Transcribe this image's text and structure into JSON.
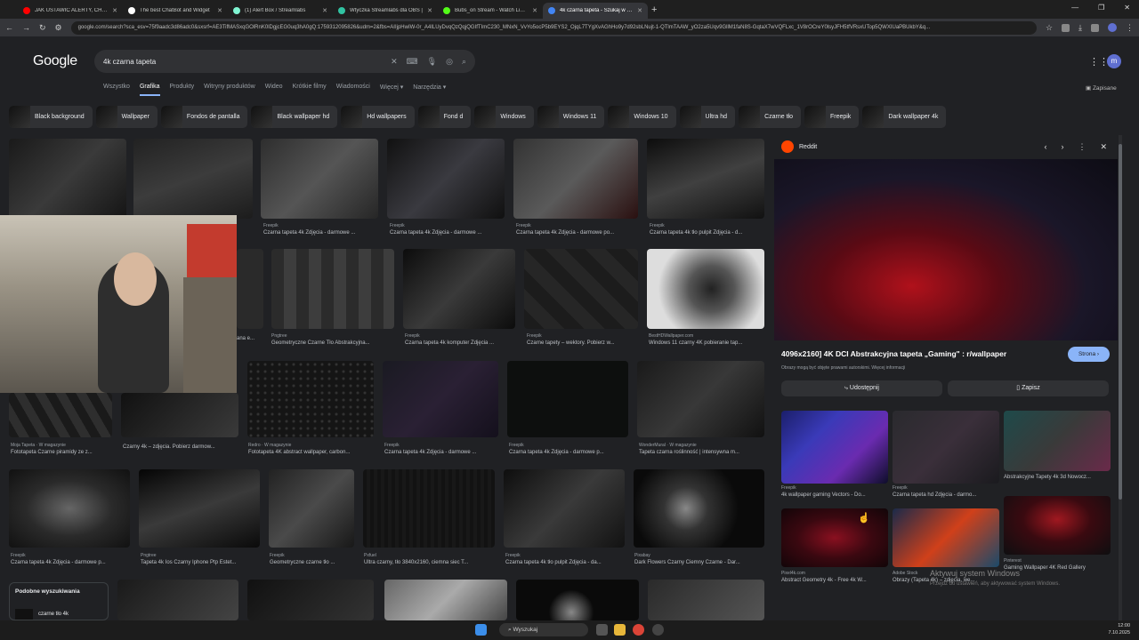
{
  "browser": {
    "tabs": [
      {
        "label": "JAK USTAWIĆ ALERTY, CHAT, IT",
        "color": "#ff0000",
        "active": false
      },
      {
        "label": "The best ChatBot and Widget",
        "color": "#ffffff",
        "active": false
      },
      {
        "label": "(1) Alert Box / Streamlabs",
        "color": "#80f5d2",
        "active": false
      },
      {
        "label": "Wtyczka Streamlabs dla OBS |",
        "color": "#31c3a2",
        "active": false
      },
      {
        "label": "Bubs_on Stream - Watch Live o",
        "color": "#53fc18",
        "active": false
      },
      {
        "label": "4k czarna tapeta - Szukaj w Go",
        "color": "#4285f4",
        "active": true
      }
    ],
    "url": "google.com/search?sca_esv=75f9aadc3d86adc0&sxsrf=AE3TifMASxqGOlRnK0lDgjcEG0uq3hA0gQ:1759312095826&udm=2&fbs=AIIjpHwIW-0r_A4ILUyDvqQzQqjQGIfTImC230_MNxN_VvYo5ocP5b9EYS2_OjqL7TYgXvAGhHo9y7d92sbLNujt-1-QTlmTAAW_yO2za5Uqv9GllM1faN8S-GqtaX7wVQFLxc_1V8rOCreY0lsyJFH5tfVRsxUTop5QWXIUaPBUkbY&q..."
  },
  "header": {
    "logo": "Google",
    "query": "4k czarna tapeta",
    "nav": [
      "Wszystko",
      "Grafika",
      "Produkty",
      "Witryny produktów",
      "Wideo",
      "Krótkie filmy",
      "Wiadomości",
      "Więcej ▾",
      "Narzędzia ▾"
    ],
    "active_nav": "Grafika",
    "saved": "Zapisane",
    "avatar_letter": "m"
  },
  "chips": [
    "Black background",
    "Wallpaper",
    "Fondos de pantalla",
    "Black wallpaper hd",
    "Hd wallpapers",
    "Fond d",
    "Windows",
    "Windows 11",
    "Windows 10",
    "Ultra hd",
    "Czarne tło",
    "Freepik",
    "Dark wallpaper 4k"
  ],
  "results": [
    {
      "src": "Freepik",
      "title": "Czarna tapeta 4k Zdjęcia - darmowe ..."
    },
    {
      "src": "Freepik",
      "title": "Czarna tapeta 4k Zdjęcia - darmowe ..."
    },
    {
      "src": "Freepik",
      "title": "Czarna tapeta 4k Zdjęcia - darmowe po..."
    },
    {
      "src": "Freepik",
      "title": "Czarna tapeta 4k tło pulpit Zdjęcia - d..."
    },
    {
      "src": "",
      "title": "ana e..."
    },
    {
      "src": "Pngtree",
      "title": "Geometryczne Czarne Tło Abstrakcyjna..."
    },
    {
      "src": "Freepik",
      "title": "Czarna tapeta 4k komputer Zdjęcia ..."
    },
    {
      "src": "Freepik",
      "title": "Czarne tapety – wektory. Pobierz w..."
    },
    {
      "src": "BestHDWallpaper.com",
      "title": "Windows 11 czarny 4K pobieranie tap..."
    },
    {
      "src": "Moja Tapeta · W magazynie",
      "title": "Fototapeta Czarne piramidy ze z..."
    },
    {
      "src": "",
      "title": "Czarny 4k – zdjęcia. Pobierz darmow..."
    },
    {
      "src": "Redro · W magazynie",
      "title": "Fototapeta 4K abstract wallpaper, carbon..."
    },
    {
      "src": "Freepik",
      "title": "Czarna tapeta 4k Zdjęcia - darmowe ..."
    },
    {
      "src": "Freepik",
      "title": "Czarna tapeta 4k Zdjęcia - darmowe p..."
    },
    {
      "src": "WonderMural · W magazynie",
      "title": "Tapeta czarna roślinność | intensywna m..."
    },
    {
      "src": "Freepik",
      "title": "Czarna tapeta 4k Zdjęcia - darmowe p..."
    },
    {
      "src": "Pngtree",
      "title": "Tapeta 4k Ios Czarny Iphone Ptp Estet..."
    },
    {
      "src": "Freepik",
      "title": "Geometryczne czarne tło ..."
    },
    {
      "src": "Pxfuel",
      "title": "Ultra czarny, tło 3840x2160, ciemna siec T..."
    },
    {
      "src": "Freepik",
      "title": "Czarna tapeta 4k tło pulpit Zdjęcia - da..."
    },
    {
      "src": "Pixabay",
      "title": "Dark Flowers Czarny Ciemny Czarne - Dar..."
    }
  ],
  "related_search": {
    "title": "Podobne wyszukiwania",
    "item": "czarne tło 4k"
  },
  "panel": {
    "source": "Reddit",
    "title": "4096x2160] 4K DCI Abstrakcyjna tapeta „Gaming\" : r/wallpaper",
    "note": "Obrazy mogą być objęte prawami autorskimi. Więcej informacji",
    "visit": "Strona ›",
    "share": "Udostępnij",
    "save": "Zapisz",
    "related": [
      {
        "src": "Freepik",
        "title": "4k wallpaper gaming Vectors - Do..."
      },
      {
        "src": "Freepik",
        "title": "Czarna tapeta hd Zdjęcia - darmo..."
      },
      {
        "src": "",
        "title": "Abstrakcyjne Tapety 4k 3d Nowocz..."
      },
      {
        "src": "Pixel4k.com",
        "title": "Abstract Geometry 4k - Free 4k W..."
      },
      {
        "src": "Adobe Stock",
        "title": "Obrazy (Tapeta 4k) – zdjęcia, we..."
      },
      {
        "src": "Pinterest",
        "title": "Gaming Wallpaper 4K Red Gallery"
      }
    ]
  },
  "watermark": {
    "line1": "Aktywuj system Windows",
    "line2": "Przejdź do ustawień, aby aktywować system Windows."
  },
  "taskbar": {
    "search": "Wyszukaj",
    "time": "12:00",
    "date": "7.10.2025"
  }
}
